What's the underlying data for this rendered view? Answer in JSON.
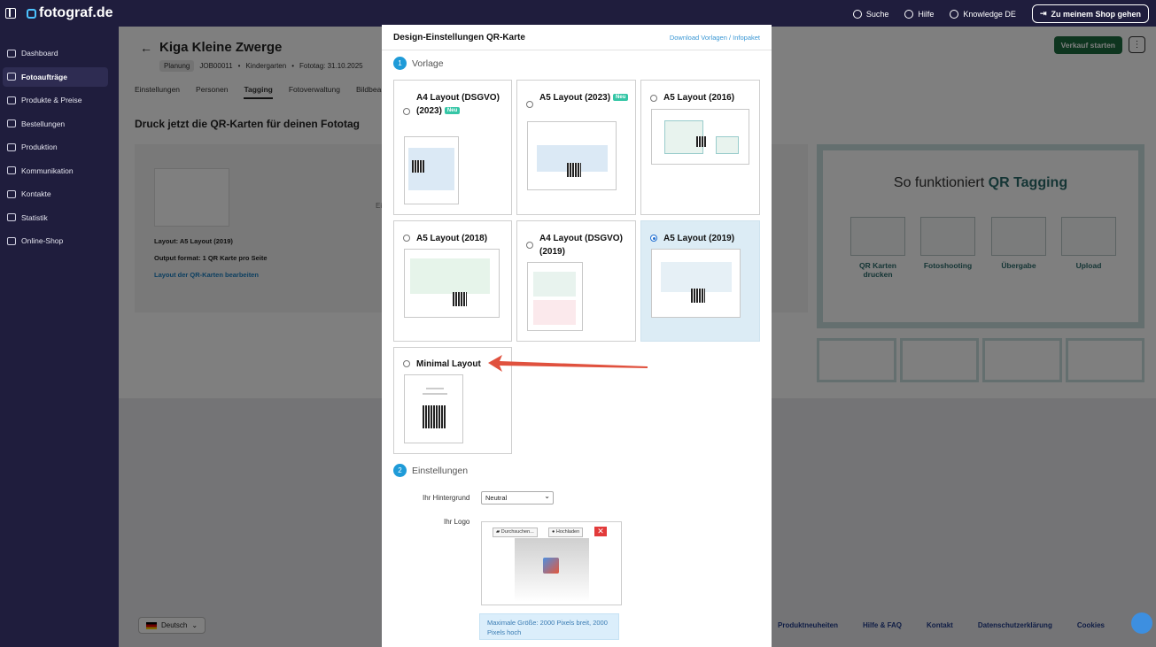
{
  "topbar": {
    "brand": "fotograf.de",
    "search_label": "Suche",
    "help_label": "Hilfe",
    "knowledge_label": "Knowledge DE",
    "shop_button": "Zu meinem Shop gehen"
  },
  "sidebar": {
    "items": [
      {
        "label": "Dashboard",
        "active": false
      },
      {
        "label": "Fotoaufträge",
        "active": true
      },
      {
        "label": "Produkte & Preise",
        "active": false
      },
      {
        "label": "Bestellungen",
        "active": false
      },
      {
        "label": "Produktion",
        "active": false
      },
      {
        "label": "Kommunikation",
        "active": false
      },
      {
        "label": "Kontakte",
        "active": false
      },
      {
        "label": "Statistik",
        "active": false
      },
      {
        "label": "Online-Shop",
        "active": false
      }
    ]
  },
  "job": {
    "title": "Kiga Kleine Zwerge",
    "status": "Planung",
    "job_id": "JOB00011",
    "category": "Kindergarten",
    "date": "Fototag: 31.10.2025",
    "start_button": "Verkauf starten",
    "tabs": [
      "Einstellungen",
      "Personen",
      "Tagging",
      "Fotoverwaltung",
      "Bildbearb"
    ],
    "heading": "Druck jetzt die QR-Karten für deinen Fototag",
    "layout_line": "Layout: A5 Layout (2019)",
    "output_line": "Output format: 1 QR Karte pro Seite",
    "edit_link": "Layout der QR-Karten bearbeiten",
    "faded_text": "Ei"
  },
  "how_it_works": {
    "title_prefix": "So funktioniert",
    "title_accent": "QR Tagging",
    "steps": [
      "QR Karten drucken",
      "Fotoshooting",
      "Übergabe",
      "Upload"
    ]
  },
  "footer": {
    "language": "Deutsch",
    "links": [
      "Produktneuheiten",
      "Hilfe & FAQ",
      "Kontakt",
      "Datenschutzerklärung",
      "Cookies"
    ]
  },
  "modal": {
    "title": "Design-Einstellungen QR-Karte",
    "download_link": "Download Vorlagen / Infopaket",
    "section1": {
      "number": "1",
      "label": "Vorlage"
    },
    "section2": {
      "number": "2",
      "label": "Einstellungen"
    },
    "new_badge": "Neu",
    "templates": [
      {
        "name": "A4 Layout (DSGVO) (2023)",
        "new": true,
        "selected": false
      },
      {
        "name": "A5 Layout (2023)",
        "new": true,
        "selected": false
      },
      {
        "name": "A5 Layout (2016)",
        "new": false,
        "selected": false
      },
      {
        "name": "A5 Layout (2018)",
        "new": false,
        "selected": false
      },
      {
        "name": "A4 Layout (DSGVO) (2019)",
        "new": false,
        "selected": false
      },
      {
        "name": "A5 Layout (2019)",
        "new": false,
        "selected": true
      },
      {
        "name": "Minimal Layout",
        "new": false,
        "selected": false
      }
    ],
    "background_label": "Ihr Hintergrund",
    "background_value": "Neutral",
    "logo_label": "Ihr Logo",
    "browse_button": "Durchsuchen...",
    "upload_button": "Hochladen",
    "remove_icon": "✕",
    "max_size_info": "Maximale Größe: 2000 Pixels breit, 2000 Pixels hoch"
  },
  "colors": {
    "accent": "#1f9bd8",
    "sidebar": "#1f1d3d",
    "primary_green": "#1d6b3f",
    "annotation_arrow": "#e0513e"
  }
}
